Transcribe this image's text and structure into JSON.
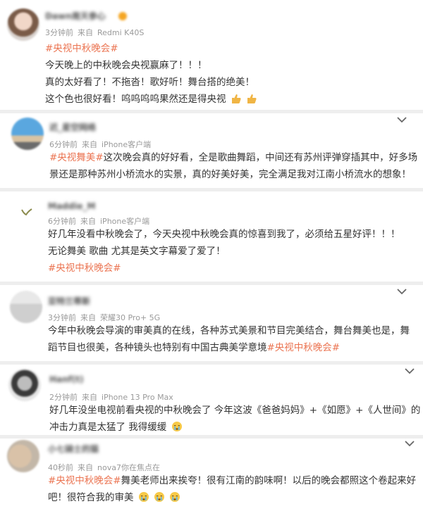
{
  "comments": [
    {
      "name": "Dawn南天参心",
      "time": "3分钟前",
      "source_prefix": "来自",
      "device": "Redmi K40S",
      "tag": "#央视中秋晚会#",
      "lines": [
        "今天晚上的中秋晚会央视赢麻了！！！",
        "真的太好看了！不拖沓！歌好听！舞台搭的绝美！",
        "这个色也很好看！呜呜呜呜果然还是得央视"
      ],
      "emoji": "thumbs-up-emoji"
    },
    {
      "name": "迟_星空网络",
      "time": "6分钟前",
      "source_prefix": "来自",
      "device": "iPhone客户端",
      "tag": "#央视舞美#",
      "line1_rest": "这次晚会真的好好看，全是歌曲舞蹈，中间还有苏州评弹穿插其中，好多场",
      "line2": "景还是那种苏州小桥流水的实景，真的好美好美，完全满足我对江南小桥流水的想象！"
    },
    {
      "name": "Maddie_M",
      "time": "6分钟前",
      "source_prefix": "来自",
      "device": "iPhone客户端",
      "line1": "好几年没看中秋晚会了，今天央视中秋晚会真的惊喜到我了，必须给五星好评！！！",
      "line2": "无论舞美 歌曲 尤其是英文字幕爱了爱了！",
      "tag": "#央视中秋晚会#"
    },
    {
      "name": "亚特兰蒂斯",
      "time": "3分钟前",
      "source_prefix": "来自",
      "device": "荣耀30 Pro+ 5G",
      "line1": "今年中秋晚会导演的审美真的在线，各种苏式美景和节目完美结合，舞台舞美也是，舞",
      "line2_prefix": "蹈节目也很美，各种镜头也特别有中国古典美学意境",
      "tag": "#央视中秋晚会#"
    },
    {
      "name": "Hanf(t)",
      "time": "2分钟前",
      "source_prefix": "来自",
      "device": "iPhone 13 Pro Max",
      "line1": "好几年没坐电视前看央视的中秋晚会了 今年这波《爸爸妈妈》+《如愿》+《人世间》的",
      "line2": "冲击力真是太猛了 我得缓缓",
      "emoji": "crying-face-emoji"
    },
    {
      "name": "小七骑士的猫",
      "time": "40秒前",
      "source_prefix": "来自",
      "device": "nova7你在焦点在",
      "tag": "#央视中秋晚会#",
      "line1_rest": "舞美老师出来挨夸！很有江南的韵味啊！以后的晚会都照这个卷起来好",
      "line2": "吧！很符合我的审美",
      "emoji": "crying-face-emoji"
    }
  ],
  "colors": {
    "tag": "#eb7350",
    "meta": "#9a9a9a",
    "separator": "#eeeeee"
  }
}
